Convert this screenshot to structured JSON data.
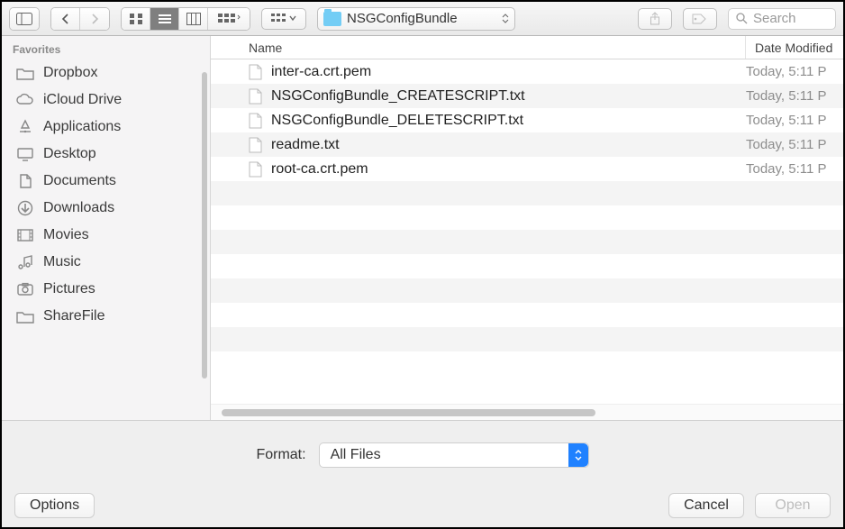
{
  "toolbar": {
    "location_label": "NSGConfigBundle",
    "search_placeholder": "Search"
  },
  "sidebar": {
    "heading": "Favorites",
    "items": [
      {
        "label": "Dropbox"
      },
      {
        "label": "iCloud Drive"
      },
      {
        "label": "Applications"
      },
      {
        "label": "Desktop"
      },
      {
        "label": "Documents"
      },
      {
        "label": "Downloads"
      },
      {
        "label": "Movies"
      },
      {
        "label": "Music"
      },
      {
        "label": "Pictures"
      },
      {
        "label": "ShareFile"
      }
    ]
  },
  "columns": {
    "name": "Name",
    "date_modified": "Date Modified"
  },
  "files": [
    {
      "name": "inter-ca.crt.pem",
      "date": "Today, 5:11 P"
    },
    {
      "name": "NSGConfigBundle_CREATESCRIPT.txt",
      "date": "Today, 5:11 P"
    },
    {
      "name": "NSGConfigBundle_DELETESCRIPT.txt",
      "date": "Today, 5:11 P"
    },
    {
      "name": "readme.txt",
      "date": "Today, 5:11 P"
    },
    {
      "name": "root-ca.crt.pem",
      "date": "Today, 5:11 P"
    }
  ],
  "format": {
    "label": "Format:",
    "value": "All Files"
  },
  "buttons": {
    "options": "Options",
    "cancel": "Cancel",
    "open": "Open"
  }
}
